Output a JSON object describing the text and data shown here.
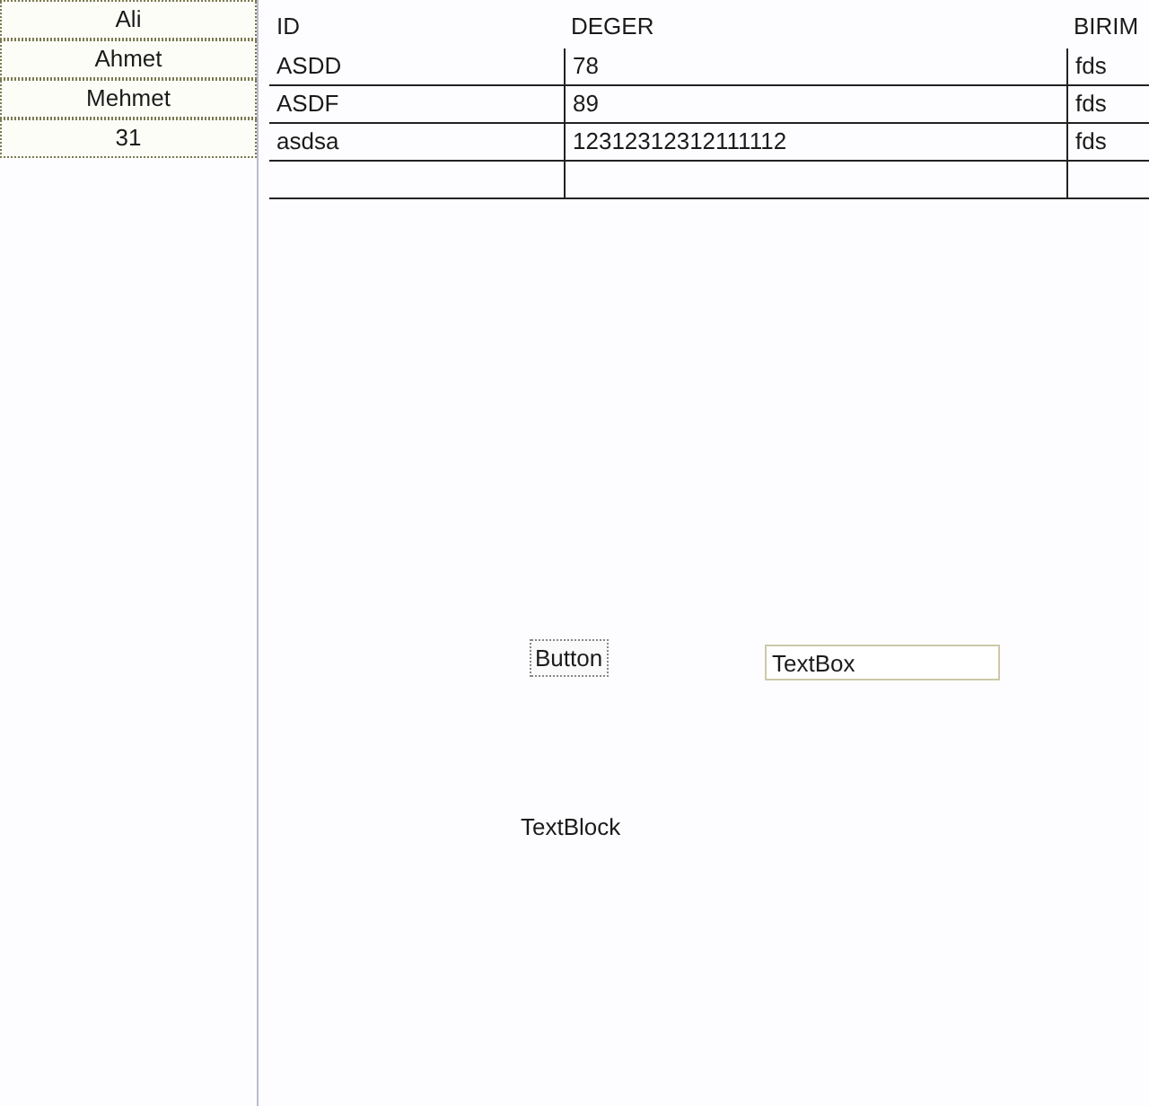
{
  "list_items": [
    "Ali",
    "Ahmet",
    "Mehmet",
    "31"
  ],
  "table": {
    "columns": [
      "ID",
      "DEGER",
      "BIRIM"
    ],
    "rows": [
      [
        "ASDD",
        "78",
        "fds"
      ],
      [
        "ASDF",
        "89",
        "fds"
      ],
      [
        "asdsa",
        "12312312312111112",
        "fds"
      ],
      [
        "",
        "",
        ""
      ]
    ]
  },
  "button": {
    "label": "Button"
  },
  "textbox": {
    "value": "TextBox"
  },
  "textblock": "TextBlock"
}
